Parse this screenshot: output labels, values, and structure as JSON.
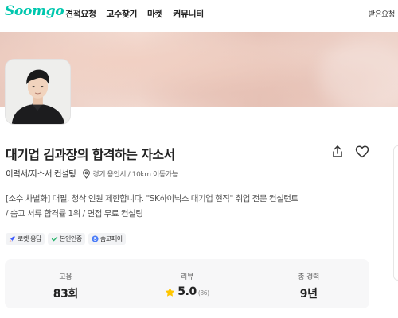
{
  "header": {
    "logo": "Soomgo",
    "nav": [
      "견적요청",
      "고수찾기",
      "마켓",
      "커뮤니티"
    ],
    "received": "받은요청"
  },
  "profile": {
    "title": "대기업 김과장의 합격하는 자소서",
    "category": "이력서/자소서 컨설팅",
    "location": "경기 용인시 / 10km 이동가능",
    "description_lines": [
      "[소수 차별화] 대필, 청삭 인원 제한합니다. \"SK하이닉스 대기업 현직\" 취업 전문 컨설턴트",
      "/ 숨고 서류 합격률 1위 / 면접 무료 컨설팅"
    ],
    "badges": [
      "로켓 응답",
      "본인인증",
      "숨고페이"
    ]
  },
  "stats": {
    "hire": {
      "label": "고용",
      "value": "83회"
    },
    "review": {
      "label": "리뷰",
      "value": "5.0",
      "count": "(86)"
    },
    "career": {
      "label": "총 경력",
      "value": "9년"
    }
  },
  "colors": {
    "brand": "#00c7ae",
    "star": "#ffc600",
    "rocket": "#3d5afe",
    "check": "#27b36b",
    "pay": "#4a7cf7"
  },
  "icons": [
    "location-icon",
    "share-icon",
    "heart-icon",
    "rocket-icon",
    "check-icon",
    "soomgo-pay-icon",
    "star-icon"
  ]
}
